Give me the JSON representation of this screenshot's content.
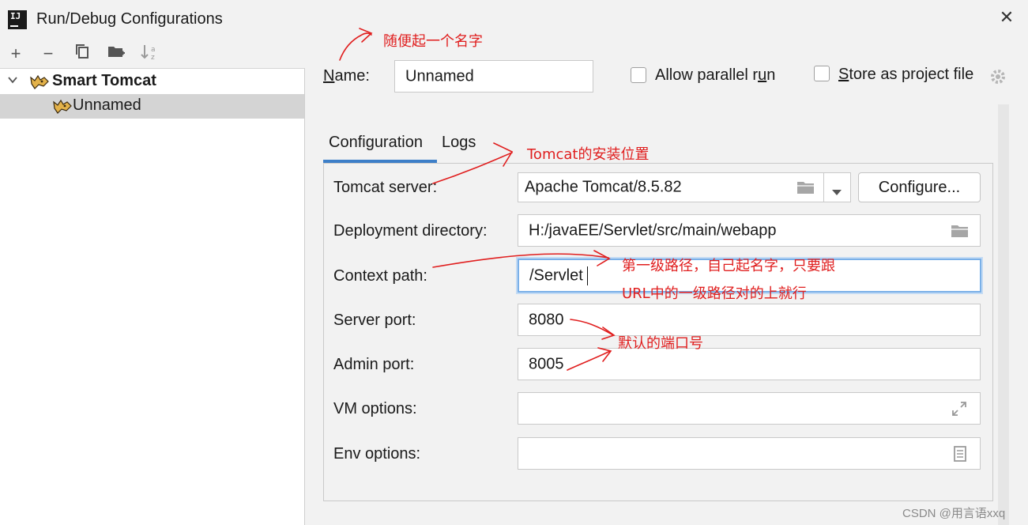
{
  "window": {
    "title": "Run/Debug Configurations",
    "app_icon_text": "IJ"
  },
  "toolbar": {
    "add": "+",
    "remove": "−"
  },
  "tree": {
    "group": {
      "label": "Smart Tomcat"
    },
    "item": {
      "label": "Unnamed"
    }
  },
  "form": {
    "name_label_mnemonic": "N",
    "name_label_rest": "ame:",
    "name_value": "Unnamed",
    "allow_parallel_pre": "Allow parallel r",
    "allow_parallel_mnemonic": "u",
    "allow_parallel_post": "n",
    "store_mnemonic": "S",
    "store_rest": "tore as project file"
  },
  "tabs": [
    {
      "label": "Configuration",
      "active": true
    },
    {
      "label": "Logs",
      "active": false
    }
  ],
  "config": {
    "tomcat_server_label": "Tomcat server:",
    "tomcat_server_value": "Apache Tomcat/8.5.82",
    "configure_button": "Configure...",
    "deployment_directory_label": "Deployment directory:",
    "deployment_directory_value": "H:/javaEE/Servlet/src/main/webapp",
    "context_path_label": "Context path:",
    "context_path_value": "/Servlet",
    "server_port_label": "Server port:",
    "server_port_value": "8080",
    "admin_port_label": "Admin port:",
    "admin_port_value": "8005",
    "vm_options_label": "VM options:",
    "vm_options_value": "",
    "env_options_label": "Env options:",
    "env_options_value": ""
  },
  "annotations": {
    "name_note": "随便起一个名字",
    "tomcat_note": "Tomcat的安装位置",
    "context_note_line1": "第一级路径，自己起名字，只要跟",
    "context_note_line2": "URL中的一级路径对的上就行",
    "port_note": "默认的端口号"
  },
  "watermark": "CSDN @用言语xxq",
  "colors": {
    "accent": "#3d7fc8",
    "annotation": "#e01e1e",
    "selection": "#d4d4d4",
    "background": "#f2f2f2"
  },
  "icons": {
    "add": "plus-icon",
    "remove": "minus-icon",
    "copy": "copy-icon",
    "folder": "new-folder-icon",
    "sort": "sort-icon",
    "tomcat": "tomcat-icon",
    "browse": "folder-icon",
    "dropdown": "chevron-down-icon",
    "expand": "expand-icon",
    "env": "document-icon",
    "settings": "gear-icon",
    "close": "close-icon"
  }
}
